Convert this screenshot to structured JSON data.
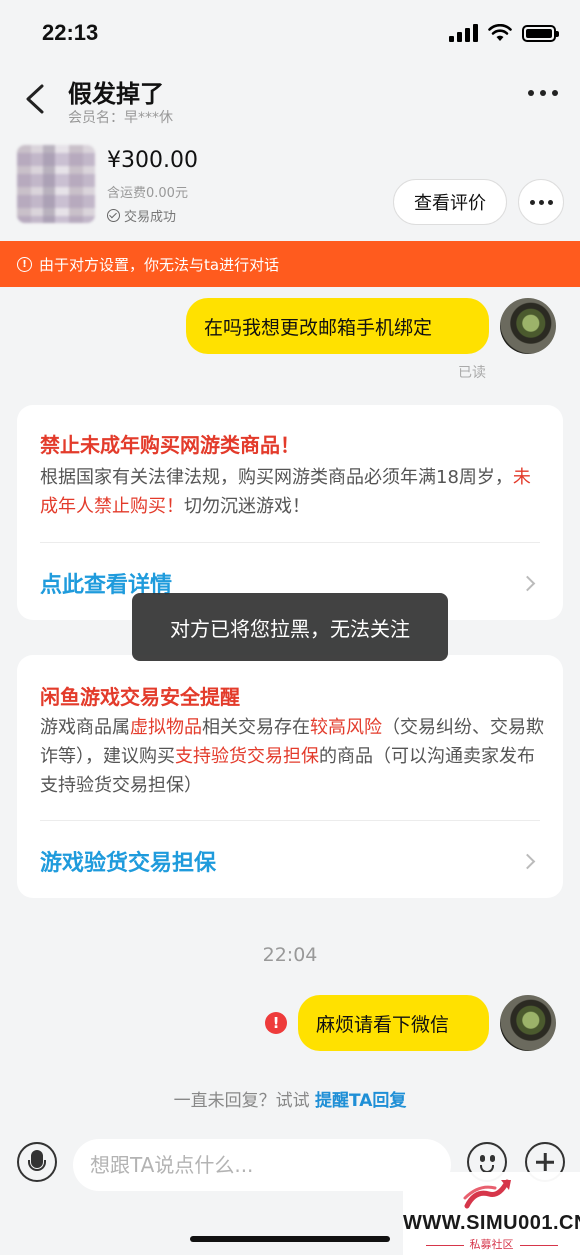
{
  "status_bar": {
    "time": "22:13"
  },
  "header": {
    "title": "假发掉了",
    "member": "会员名：早***休"
  },
  "product": {
    "price": "¥300.00",
    "shipping": "含运费0.00元",
    "deal_status": "交易成功",
    "review_label": "查看评价"
  },
  "warning": {
    "text": "由于对方设置，你无法与ta进行对话"
  },
  "messages": {
    "first": "在吗我想更改邮箱手机绑定",
    "read_status": "已读",
    "timestamp": "22:04",
    "second": "麻烦请看下微信"
  },
  "card1": {
    "title": "禁止未成年购买网游类商品！",
    "body_1": "根据国家有关法律法规，购买网游类商品必须年满18周岁，",
    "body_red": "未成年人禁止购买！",
    "body_2": "切勿沉迷游戏！",
    "link": "点此查看详情"
  },
  "card2": {
    "title": "闲鱼游戏交易安全提醒",
    "p1": "游戏商品属",
    "r1": "虚拟物品",
    "p2": "相关交易存在",
    "r2": "较高风险",
    "p3": "（交易纠纷、交易欺诈等），建议购买",
    "r3": "支持验货交易担保",
    "p4": "的商品（可以沟通卖家发布支持验货交易担保）",
    "link": "游戏验货交易担保"
  },
  "toast": {
    "text": "对方已将您拉黑，无法关注"
  },
  "remind": {
    "prefix": "一直未回复？试试",
    "action": "提醒TA回复"
  },
  "input": {
    "placeholder": "想跟TA说点什么..."
  },
  "watermark": {
    "text": "WWW.SIMU001.CN",
    "sub": "私募社区"
  },
  "colors": {
    "accent": "#ffe100",
    "warning": "#ff5b1e",
    "link": "#1f9bdc",
    "alert_red": "#e33b2b"
  }
}
